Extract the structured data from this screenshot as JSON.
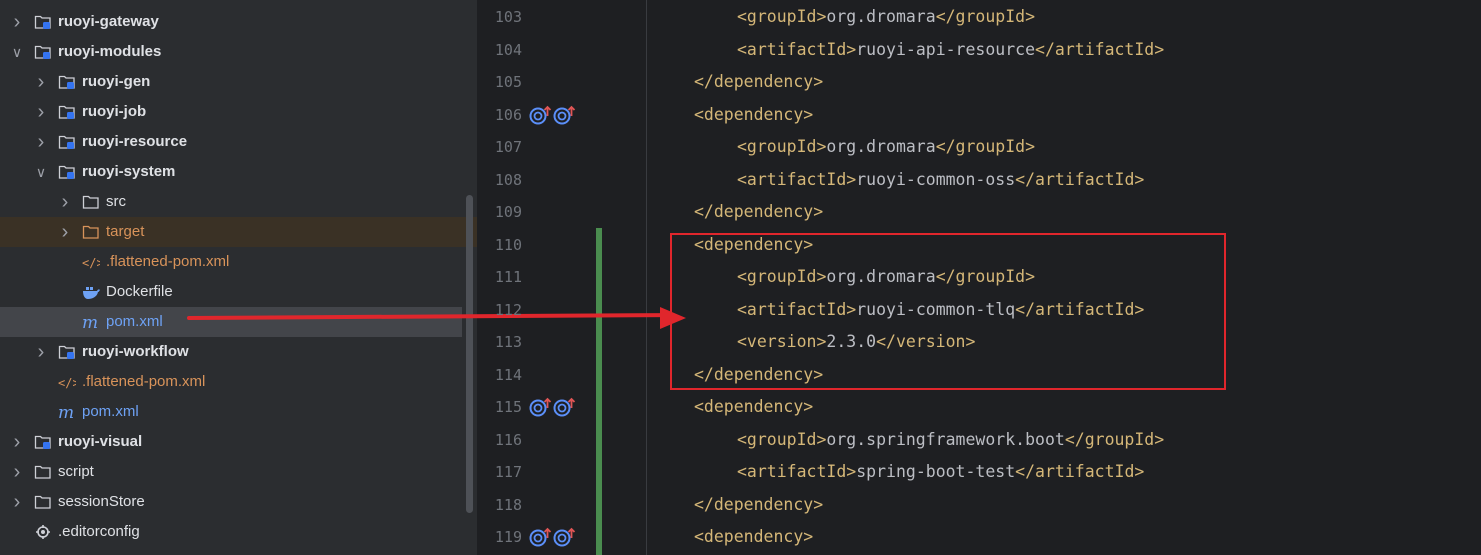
{
  "project_tree": {
    "items": [
      {
        "label": "ruoyi-gateway",
        "kind": "module",
        "depth": 1,
        "expanded": false
      },
      {
        "label": "ruoyi-modules",
        "kind": "module",
        "depth": 1,
        "expanded": true
      },
      {
        "label": "ruoyi-gen",
        "kind": "module",
        "depth": 2,
        "expanded": false
      },
      {
        "label": "ruoyi-job",
        "kind": "module",
        "depth": 2,
        "expanded": false
      },
      {
        "label": "ruoyi-resource",
        "kind": "module",
        "depth": 2,
        "expanded": false
      },
      {
        "label": "ruoyi-system",
        "kind": "module",
        "depth": 2,
        "expanded": true
      },
      {
        "label": "src",
        "kind": "folder",
        "depth": 3,
        "expanded": false
      },
      {
        "label": "target",
        "kind": "excluded-folder",
        "depth": 3,
        "expanded": false
      },
      {
        "label": ".flattened-pom.xml",
        "kind": "xml-file",
        "depth": 3
      },
      {
        "label": "Dockerfile",
        "kind": "docker-file",
        "depth": 3
      },
      {
        "label": "pom.xml",
        "kind": "maven-file",
        "depth": 3,
        "selected": true
      },
      {
        "label": "ruoyi-workflow",
        "kind": "module",
        "depth": 2,
        "expanded": false
      },
      {
        "label": ".flattened-pom.xml",
        "kind": "xml-file",
        "depth": 2
      },
      {
        "label": "pom.xml",
        "kind": "maven-file",
        "depth": 2
      },
      {
        "label": "ruoyi-visual",
        "kind": "module",
        "depth": 1,
        "expanded": false
      },
      {
        "label": "script",
        "kind": "folder",
        "depth": 1,
        "expanded": false
      },
      {
        "label": "sessionStore",
        "kind": "folder",
        "depth": 1,
        "expanded": false
      },
      {
        "label": ".editorconfig",
        "kind": "config-file",
        "depth": 1
      }
    ]
  },
  "editor": {
    "lines": [
      {
        "num": "103",
        "indent": 2,
        "code": "<groupId>org.dromara</groupId>"
      },
      {
        "num": "104",
        "indent": 2,
        "code": "<artifactId>ruoyi-api-resource</artifactId>"
      },
      {
        "num": "105",
        "indent": 1,
        "code": "</dependency>"
      },
      {
        "num": "106",
        "indent": 1,
        "code": "<dependency>",
        "gutter_icons": true
      },
      {
        "num": "107",
        "indent": 2,
        "code": "<groupId>org.dromara</groupId>"
      },
      {
        "num": "108",
        "indent": 2,
        "code": "<artifactId>ruoyi-common-oss</artifactId>"
      },
      {
        "num": "109",
        "indent": 1,
        "code": "</dependency>"
      },
      {
        "num": "110",
        "indent": 1,
        "code": "<dependency>"
      },
      {
        "num": "111",
        "indent": 2,
        "code": "<groupId>org.dromara</groupId>"
      },
      {
        "num": "112",
        "indent": 2,
        "code": "<artifactId>ruoyi-common-tlq</artifactId>"
      },
      {
        "num": "113",
        "indent": 2,
        "code": "<version>2.3.0</version>"
      },
      {
        "num": "114",
        "indent": 1,
        "code": "</dependency>"
      },
      {
        "num": "115",
        "indent": 1,
        "code": "<dependency>",
        "gutter_icons": true
      },
      {
        "num": "116",
        "indent": 2,
        "code": "<groupId>org.springframework.boot</groupId>"
      },
      {
        "num": "117",
        "indent": 2,
        "code": "<artifactId>spring-boot-test</artifactId>"
      },
      {
        "num": "118",
        "indent": 1,
        "code": "</dependency>"
      },
      {
        "num": "119",
        "indent": 1,
        "code": "<dependency>",
        "gutter_icons": true
      }
    ],
    "gutter_icon_names": [
      "maven-dependency-up-icon",
      "maven-dependency-up-icon"
    ],
    "highlighted_lines": [
      "110",
      "114"
    ]
  },
  "colors": {
    "tag": "#d5b778",
    "text": "#bcbec4",
    "annotation": "#e0262c",
    "change_marker": "#4a8c4f"
  }
}
